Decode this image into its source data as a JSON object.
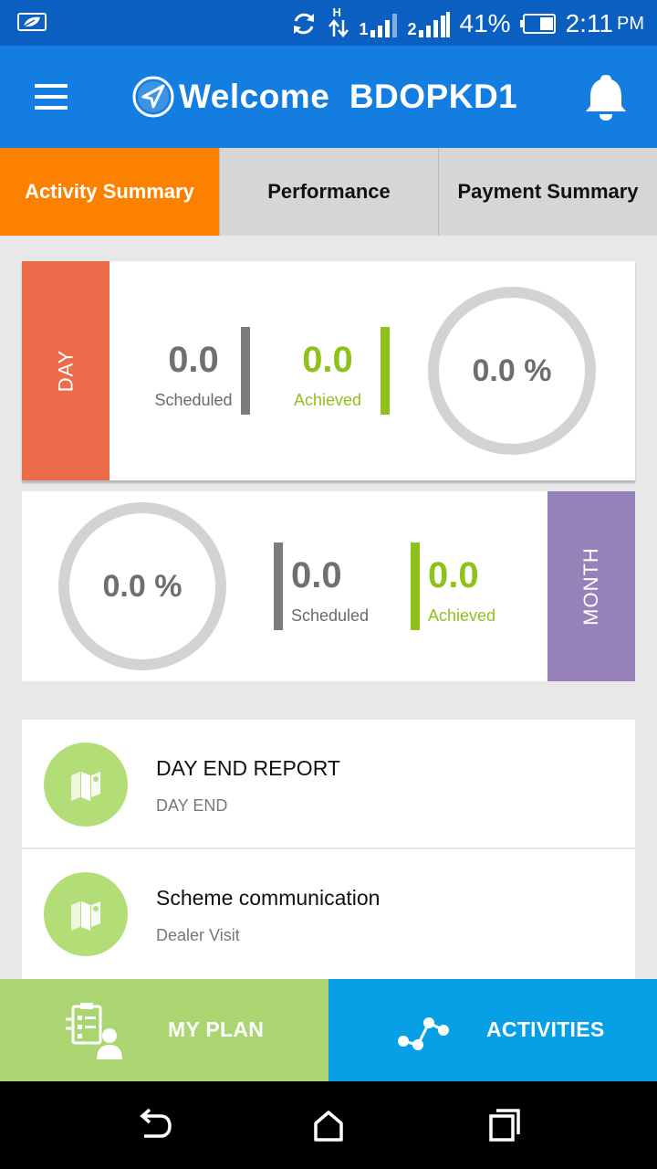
{
  "status_bar": {
    "battery_percent": "41%",
    "time": "2:11",
    "ampm": "PM",
    "network_type": "H",
    "sim1": "1",
    "sim2": "2",
    "icons": [
      "leaf-notification-icon",
      "sync-icon",
      "data-arrows-icon",
      "signal-sim1-icon",
      "signal-sim2-icon",
      "battery-icon"
    ]
  },
  "app_bar": {
    "welcome_text": "Welcome  BDOPKD1",
    "icons": [
      "menu-icon",
      "navigation-logo-icon",
      "bell-icon"
    ]
  },
  "tabs": [
    {
      "label": "Activity Summary",
      "active": true
    },
    {
      "label": "Performance",
      "active": false
    },
    {
      "label": "Payment Summary",
      "active": false
    }
  ],
  "day_summary": {
    "label": "DAY",
    "scheduled_value": "0.0",
    "scheduled_label": "Scheduled",
    "achieved_value": "0.0",
    "achieved_label": "Achieved",
    "percent": "0.0 %"
  },
  "month_summary": {
    "label": "MONTH",
    "scheduled_value": "0.0",
    "scheduled_label": "Scheduled",
    "achieved_value": "0.0",
    "achieved_label": "Achieved",
    "percent": "0.0 %"
  },
  "activity_list": [
    {
      "title": "DAY END REPORT",
      "subtitle": "DAY END",
      "icon": "map-fold-icon"
    },
    {
      "title": "Scheme communication",
      "subtitle": "Dealer Visit",
      "icon": "map-fold-icon"
    }
  ],
  "action_bar": {
    "my_plan_label": "MY PLAN",
    "activities_label": "ACTIVITIES",
    "icons": [
      "plan-clipboard-icon",
      "activity-graph-icon"
    ]
  },
  "nav_bar": {
    "icons": [
      "back-icon",
      "home-icon",
      "recents-icon"
    ]
  },
  "colors": {
    "status_bar": "#0a5fc0",
    "app_bar": "#137de0",
    "active_tab": "#fc8100",
    "day_label": "#ec6b4a",
    "month_label": "#9681b8",
    "achieved_green": "#8ec21b",
    "list_icon_bg": "#b2dd77",
    "my_plan_bg": "#abd571",
    "activities_bg": "#07a0e6"
  }
}
